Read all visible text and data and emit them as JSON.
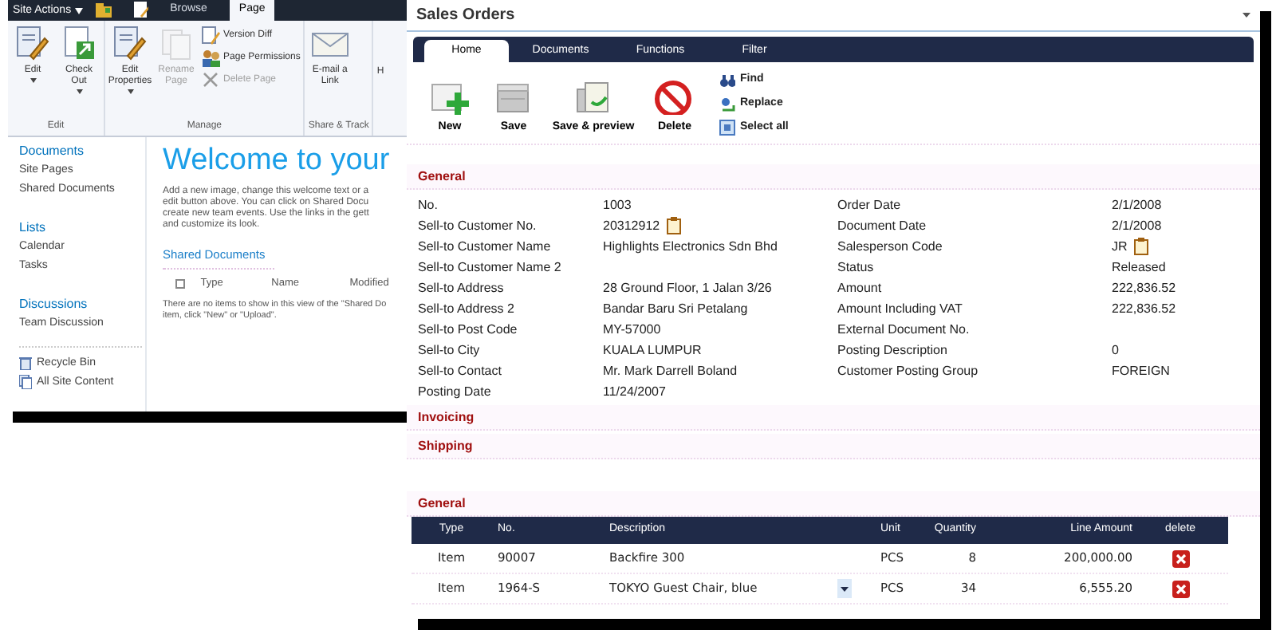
{
  "sharepoint": {
    "site_actions": "Site Actions",
    "tabs": [
      {
        "label": "Browse",
        "selected": false
      },
      {
        "label": "Page",
        "selected": true
      }
    ],
    "ribbon_groups": [
      {
        "label": "Edit",
        "buttons": [
          {
            "label": "Edit",
            "kind": "large",
            "menu": true,
            "disabled": false
          },
          {
            "label": "Check Out",
            "kind": "large",
            "menu": true,
            "disabled": false
          }
        ]
      },
      {
        "label": "Manage",
        "buttons": [
          {
            "label": "Edit Properties",
            "kind": "large",
            "menu": true,
            "disabled": false
          },
          {
            "label": "Rename Page",
            "kind": "large",
            "menu": false,
            "disabled": true
          },
          {
            "label": "Version Diff",
            "kind": "small",
            "disabled": false
          },
          {
            "label": "Page Permissions",
            "kind": "small",
            "disabled": false
          },
          {
            "label": "Delete Page",
            "kind": "small",
            "disabled": true
          }
        ]
      },
      {
        "label": "Share & Track",
        "buttons": [
          {
            "label": "E-mail a Link",
            "kind": "large",
            "menu": false,
            "disabled": false
          }
        ]
      }
    ],
    "ribbon_cut_label": "H",
    "nav_sections": [
      {
        "heading": "Documents",
        "items": [
          "Site Pages",
          "Shared Documents"
        ]
      },
      {
        "heading": "Lists",
        "items": [
          "Calendar",
          "Tasks"
        ]
      },
      {
        "heading": "Discussions",
        "items": [
          "Team Discussion"
        ]
      }
    ],
    "footer_links": [
      "Recycle Bin",
      "All Site Content"
    ],
    "title": "Welcome to your",
    "intro_lines": [
      "Add a new image, change this welcome text or a",
      "edit button above. You can click on Shared Docu",
      "create new team events. Use the links in the gett",
      "and customize its look."
    ],
    "library_title": "Shared Documents",
    "select_all_checked": false,
    "library_columns": [
      "Type",
      "Name",
      "Modified"
    ],
    "empty_lines": [
      "There are no items to show in this view of the \"Shared Do",
      "item, click \"New\" or \"Upload\"."
    ]
  },
  "sales_orders": {
    "title": "Sales Orders",
    "tabs": [
      {
        "label": "Home",
        "selected": true
      },
      {
        "label": "Documents",
        "selected": false
      },
      {
        "label": "Functions",
        "selected": false
      },
      {
        "label": "Filter",
        "selected": false
      }
    ],
    "actions": [
      "New",
      "Save",
      "Save & preview",
      "Delete"
    ],
    "small_actions": [
      "Find",
      "Replace",
      "Select all"
    ],
    "general_heading": "General",
    "fields_left": [
      {
        "label": "No.",
        "value": "1003",
        "lookup": false
      },
      {
        "label": "Sell-to Customer No.",
        "value": "20312912",
        "lookup": true
      },
      {
        "label": "Sell-to Customer Name",
        "value": "Highlights Electronics Sdn Bhd",
        "lookup": false
      },
      {
        "label": "Sell-to Customer Name 2",
        "lookup": false
      },
      {
        "label": "Sell-to Address",
        "value": "28 Ground Floor, 1 Jalan 3/26",
        "lookup": false
      },
      {
        "label": "Sell-to Address 2",
        "value": "Bandar Baru Sri Petalang",
        "lookup": false
      },
      {
        "label": "Sell-to Post Code",
        "value": "MY-57000",
        "lookup": false
      },
      {
        "label": "Sell-to City",
        "value": "KUALA LUMPUR",
        "lookup": false
      },
      {
        "label": "Sell-to Contact",
        "value": "Mr. Mark Darrell Boland",
        "lookup": false
      },
      {
        "label": "Posting Date",
        "value": "11/24/2007",
        "lookup": false
      }
    ],
    "fields_right": [
      {
        "label": "Order Date",
        "value": "2/1/2008",
        "lookup": false
      },
      {
        "label": "Document Date",
        "value": "2/1/2008",
        "lookup": false
      },
      {
        "label": "Salesperson Code",
        "value": "JR",
        "lookup": true
      },
      {
        "label": "Status",
        "value": "Released",
        "lookup": false
      },
      {
        "label": "Amount",
        "value": "222,836.52",
        "lookup": false
      },
      {
        "label": "Amount Including VAT",
        "value": "222,836.52",
        "lookup": false
      },
      {
        "label": "External Document No.",
        "lookup": false
      },
      {
        "label": "Posting Description",
        "value": "0",
        "lookup": false
      },
      {
        "label": "Customer Posting Group",
        "value": "FOREIGN",
        "lookup": false
      }
    ],
    "collapsed_sections": [
      "Invoicing",
      "Shipping"
    ],
    "lines_heading": "General",
    "lines_columns": [
      "Type",
      "No.",
      "Description",
      "Unit",
      "Quantity",
      "Line Amount",
      "delete"
    ],
    "lines": [
      {
        "type": "Item",
        "no": "90007",
        "description": "Backfire 300",
        "unit": "PCS",
        "quantity": "8",
        "line_amount": "200,000.00",
        "editing": false
      },
      {
        "type": "Item",
        "no": "1964-S",
        "description": "TOKYO Guest Chair, blue",
        "unit": "PCS",
        "quantity": "34",
        "line_amount": "6,555.20",
        "editing": true
      }
    ]
  }
}
